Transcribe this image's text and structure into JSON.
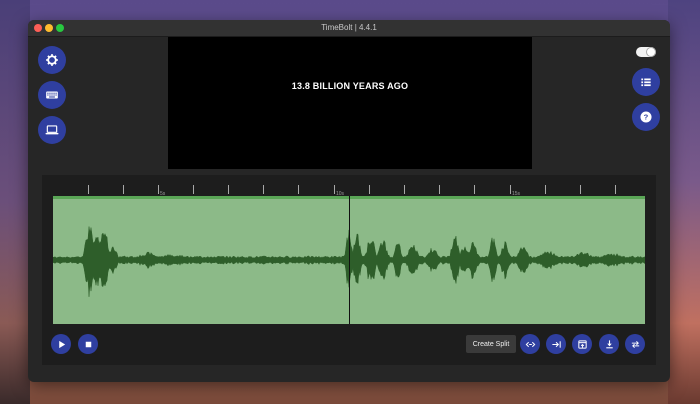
{
  "window": {
    "title": "TimeBolt | 4.4.1"
  },
  "preview": {
    "caption": "13.8 BILLION YEARS AGO"
  },
  "left_tools": [
    {
      "icon": "gear-icon"
    },
    {
      "icon": "keyboard-icon"
    },
    {
      "icon": "laptop-icon"
    }
  ],
  "right_tools": [
    {
      "icon": "list-icon"
    },
    {
      "icon": "help-icon"
    }
  ],
  "toggle": {
    "state": "on"
  },
  "timeline": {
    "tick_labels": [
      "5s",
      "10s",
      "15s"
    ],
    "playhead_seconds": 10
  },
  "controls": {
    "play_icon": "play-icon",
    "stop_icon": "stop-icon",
    "create_split_label": "Create Split",
    "actions": [
      {
        "icon": "expand-horizontal-icon"
      },
      {
        "icon": "jump-to-end-icon"
      },
      {
        "icon": "open-window-icon"
      },
      {
        "icon": "download-icon"
      },
      {
        "icon": "swap-icon"
      }
    ]
  },
  "colors": {
    "accent": "#2f3fa0",
    "waveform_bg": "#8cba88",
    "waveform": "#2e5e2a"
  }
}
